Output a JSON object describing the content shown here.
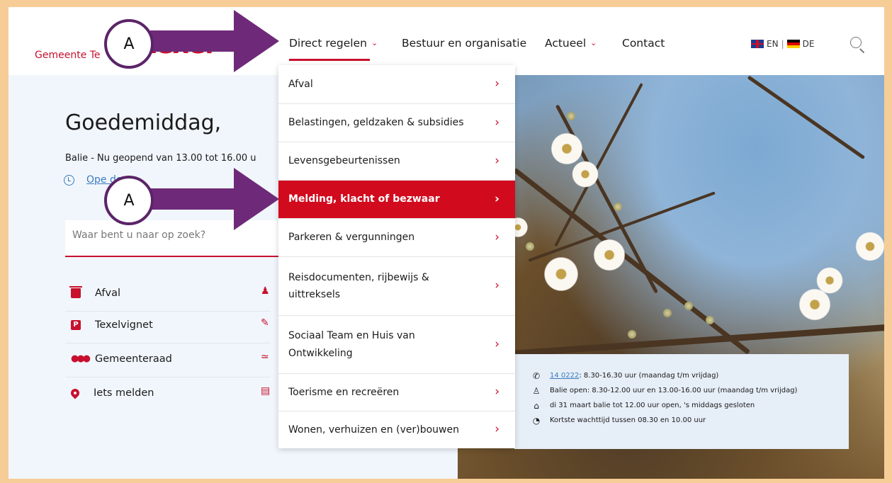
{
  "header": {
    "brand_prefix": "Gemeente Te",
    "brand_logo_fragment": "texel",
    "nav": [
      {
        "label": "Direct regelen",
        "has_dropdown": true
      },
      {
        "label": "Bestuur en organisatie",
        "has_dropdown": false
      },
      {
        "label": "Actueel",
        "has_dropdown": true
      },
      {
        "label": "Contact",
        "has_dropdown": false
      }
    ],
    "languages": [
      {
        "code": "EN"
      },
      {
        "code": "DE"
      }
    ],
    "lang_separator": "|"
  },
  "main": {
    "greeting": "Goedemiddag,",
    "balie_status": "Balie - Nu geopend van 13.00 tot 16.00 u",
    "opening_hours_link": "Ope        den",
    "search_placeholder": "Waar bent u naar op zoek?",
    "quick_links": [
      {
        "label": "Afval",
        "icon": "trash-icon"
      },
      {
        "label": "Texelvignet",
        "icon": "parking-icon"
      },
      {
        "label": "Gemeenteraad",
        "icon": "people-icon"
      },
      {
        "label": "Iets melden",
        "icon": "map-pin-icon"
      }
    ],
    "quick_links_col2_icons": [
      "person-icon",
      "edit-icon",
      "swim-icon",
      "list-icon"
    ]
  },
  "dropdown": {
    "items": [
      {
        "label": "Afval"
      },
      {
        "label": "Belastingen, geldzaken & subsidies"
      },
      {
        "label": "Levensgebeurtenissen"
      },
      {
        "label": "Melding, klacht of bezwaar",
        "active": true
      },
      {
        "label": "Parkeren & vergunningen"
      },
      {
        "label": "Reisdocumenten, rijbewijs & uittreksels"
      },
      {
        "label": "Sociaal Team en Huis van Ontwikkeling"
      },
      {
        "label": "Toerisme en recreëren"
      },
      {
        "label": "Wonen, verhuizen en (ver)bouwen"
      }
    ],
    "arrow_glyph": "›"
  },
  "info": {
    "phone_link": "14 0222",
    "phone_hours": ": 8.30-16.30 uur (maandag t/m vrijdag)",
    "balie_open": "Balie open: 8.30-12.00 uur en 13.00-16.00 uur (maandag t/m vrijdag)",
    "notice": "di 31 maart balie tot 12.00 uur open, 's middags gesloten",
    "wait": "Kortste wachttijd tussen 08.30 en 10.00 uur"
  },
  "annotations": {
    "badge_label": "A",
    "arrow_color": "#6e2a78"
  },
  "colors": {
    "brand_red": "#c8102e",
    "active_red": "#d20a1e",
    "frame": "#f6cd97",
    "panel_bg": "#f1f6fc",
    "link_blue": "#3a7bbf"
  }
}
